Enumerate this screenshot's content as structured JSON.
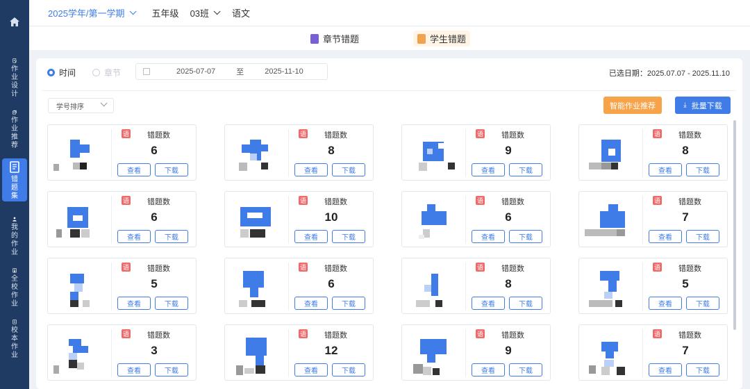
{
  "colors": {
    "accent": "#3f7ce8",
    "sidebar": "#1f3a63",
    "orange": "#f6a34a",
    "subject_badge": "#f06a6a"
  },
  "sidebar": {
    "home_icon": "home-icon",
    "items": [
      {
        "label": "作业设计",
        "icon": "edit-doc-icon"
      },
      {
        "label": "作业推荐",
        "icon": "stack-icon"
      },
      {
        "label": "错题集",
        "icon": "book-icon",
        "active": true
      },
      {
        "label": "我的作业",
        "icon": "user-icon"
      },
      {
        "label": "全校作业",
        "icon": "school-doc-icon"
      },
      {
        "label": "校本作业",
        "icon": "doc-icon"
      }
    ]
  },
  "header": {
    "term": "2025学年/第一学期",
    "grade": "五年级",
    "class": "03班",
    "subject": "语文"
  },
  "tabs": [
    {
      "label": "章节错题",
      "icon": "chapter-icon"
    },
    {
      "label": "学生错题",
      "icon": "student-icon",
      "active": true
    }
  ],
  "filter": {
    "time_label": "时间",
    "chapter_label": "章节",
    "start_date": "2025-07-07",
    "to_label": "至",
    "end_date": "2025-11-10",
    "selected_text": "已选日期：2025.07.07 - 2025.11.10"
  },
  "toolbar": {
    "sort_value": "学号排序",
    "ai_button": "智能作业推荐",
    "download_button": "批量下载"
  },
  "card_labels": {
    "subject": "语",
    "count_label": "错题数",
    "view": "查看",
    "download": "下载"
  },
  "students": [
    {
      "count": "6"
    },
    {
      "count": "8"
    },
    {
      "count": "9"
    },
    {
      "count": "8"
    },
    {
      "count": "6"
    },
    {
      "count": "10"
    },
    {
      "count": "6"
    },
    {
      "count": "7"
    },
    {
      "count": "5"
    },
    {
      "count": "6"
    },
    {
      "count": "8"
    },
    {
      "count": "5"
    },
    {
      "count": "3"
    },
    {
      "count": "12"
    },
    {
      "count": "9"
    },
    {
      "count": "7"
    }
  ]
}
